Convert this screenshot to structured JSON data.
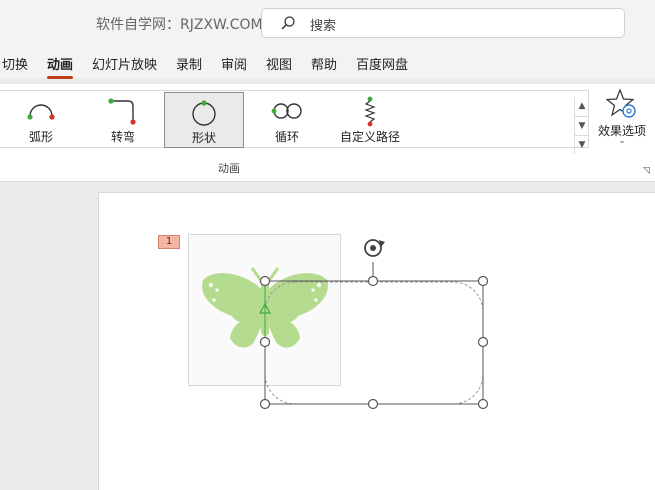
{
  "titlebar": {
    "site_label": "软件自学网：RJZXW.COM",
    "search_placeholder": "搜索"
  },
  "menu": {
    "items": [
      {
        "label": "切换"
      },
      {
        "label": "动画",
        "active": true
      },
      {
        "label": "幻灯片放映"
      },
      {
        "label": "录制"
      },
      {
        "label": "审阅"
      },
      {
        "label": "视图"
      },
      {
        "label": "帮助"
      },
      {
        "label": "百度网盘"
      }
    ]
  },
  "ribbon": {
    "gallery": [
      {
        "label": "弧形",
        "icon": "arc-path-icon"
      },
      {
        "label": "转弯",
        "icon": "turn-path-icon"
      },
      {
        "label": "形状",
        "icon": "shape-path-icon",
        "selected": true
      },
      {
        "label": "循环",
        "icon": "loop-path-icon"
      },
      {
        "label": "自定义路径",
        "icon": "custom-path-icon"
      }
    ],
    "effect_options_label": "效果选项",
    "group_label": "动画"
  },
  "slide": {
    "animation_tag": "1"
  },
  "colors": {
    "accent": "#c43e1c",
    "butterfly": "#b5dc8e",
    "path_start": "#3daa3d",
    "path_end": "#d33030",
    "tag_fill": "#f7b6a3"
  }
}
